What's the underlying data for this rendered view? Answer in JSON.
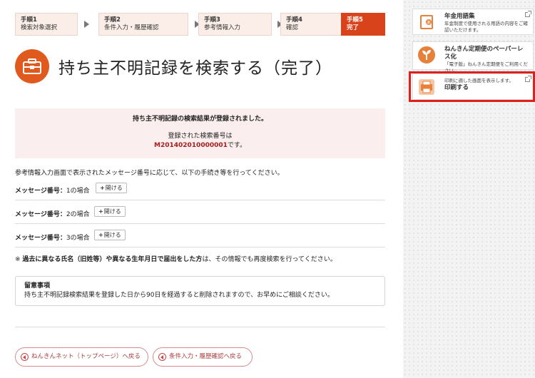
{
  "steps": [
    {
      "num": "手順1",
      "label": "検索対象選択"
    },
    {
      "num": "手順2",
      "label": "条件入力・履歴確認"
    },
    {
      "num": "手順3",
      "label": "参考情報入力"
    },
    {
      "num": "手順4",
      "label": "確認"
    },
    {
      "num": "手順5",
      "label": "完了"
    }
  ],
  "page_title": "持ち主不明記録を検索する（完了）",
  "result": {
    "line1": "持ち主不明記録の検索結果が登録されました。",
    "line2": "登録された検索番号は",
    "number": "M20140201000000 1",
    "number_clean": "M201402010000001",
    "suffix": "です。"
  },
  "intro": "参考情報入力画面で表示されたメッセージ番号に応じて、以下の手続き等を行ってください。",
  "messages": [
    {
      "prefix": "メッセージ番号：",
      "num": "1",
      "suffix": "の場合",
      "button": "開ける"
    },
    {
      "prefix": "メッセージ番号：",
      "num": "2",
      "suffix": "の場合",
      "button": "開ける"
    },
    {
      "prefix": "メッセージ番号：",
      "num": "3",
      "suffix": "の場合",
      "button": "開ける"
    }
  ],
  "note": {
    "mark": "※",
    "bold": "過去に異なる氏名（旧姓等）や異なる生年月日で届出をした方",
    "rest": "は、その情報でも再度検索を行ってください。"
  },
  "caution": {
    "title": "留意事項",
    "body": "持ち主不明記録検索結果を登録した日から90日を経過すると削除されますので、お早めにご相談ください。"
  },
  "back_buttons": {
    "top": "ねんきんネット（トップページ）へ戻る",
    "cond": "条件入力・履歴確認へ戻る"
  },
  "side": {
    "glossary": {
      "title": "年金用語集",
      "sub": "年金制度で使用される用語の内容をご確認いただけます。"
    },
    "paperless": {
      "title": "ねんきん定期便のペーパーレス化",
      "sub": "「電子版」ねんきん定期便をご利用ください。"
    },
    "print": {
      "sub": "印刷に適した画面を表示します。",
      "title": "印刷する"
    }
  },
  "colors": {
    "accent": "#d8431c",
    "highlight": "#e0201a",
    "result_bg": "#fbeeee"
  }
}
